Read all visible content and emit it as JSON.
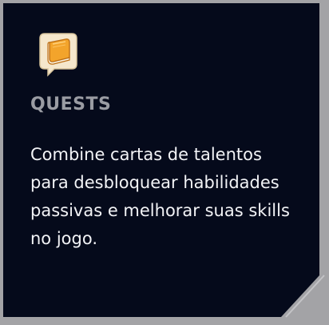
{
  "card": {
    "title": "QUESTS",
    "description": "Combine cartas de talentos para desbloquear habilidades passivas e melhorar suas skills no jogo.",
    "icon": "book-icon"
  },
  "colors": {
    "card_background": "#050a1b",
    "frame": "#a3a3a6",
    "title_text": "#9a9ca3",
    "body_text": "#f2f3f6",
    "icon_accent": "#f0a62a"
  }
}
